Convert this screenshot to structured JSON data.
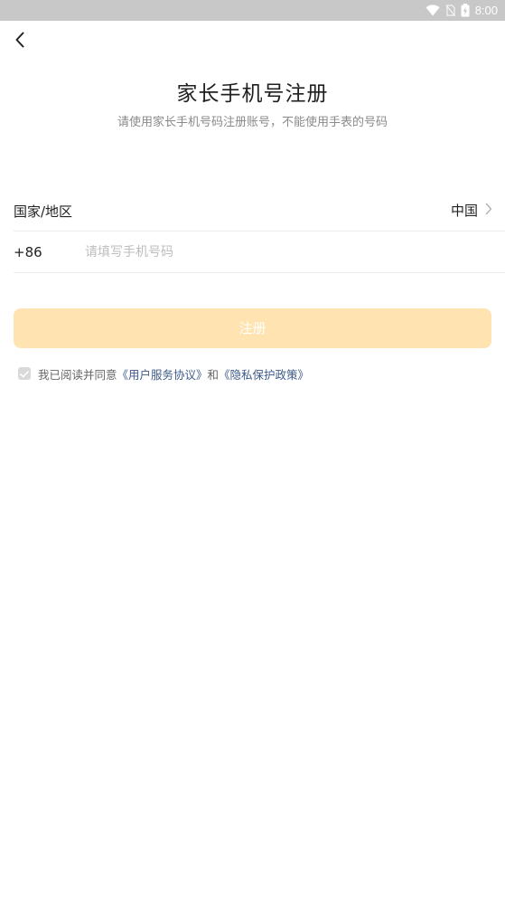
{
  "status_bar": {
    "time": "8:00"
  },
  "header": {
    "title": "家长手机号注册",
    "subtitle": "请使用家长手机号码注册账号，不能使用手表的号码"
  },
  "form": {
    "region_label": "国家/地区",
    "region_value": "中国",
    "phone_code": "+86",
    "phone_value": "",
    "phone_placeholder": "请填写手机号码"
  },
  "actions": {
    "register_label": "注册"
  },
  "agreement": {
    "checked": true,
    "prefix": "我已阅读并同意",
    "user_agreement": "《用户服务协议》",
    "conjunction": "和",
    "privacy_policy": "《隐私保护政策》"
  },
  "colors": {
    "status_bar_bg": "#c8c8c8",
    "button_bg": "#ffe3b0",
    "link": "#3d5a8a",
    "placeholder": "#bdbdbd"
  }
}
